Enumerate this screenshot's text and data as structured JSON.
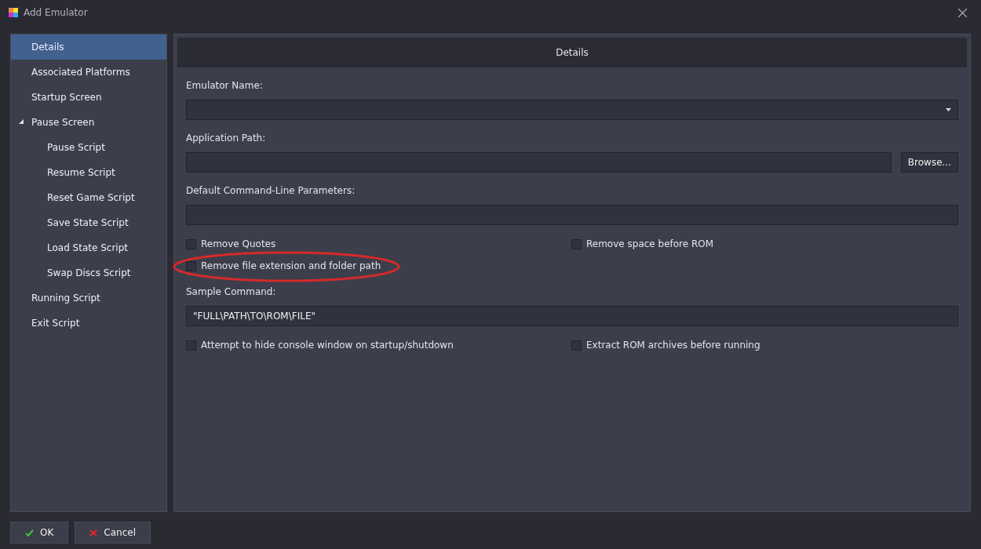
{
  "window": {
    "title": "Add Emulator"
  },
  "sidebar": {
    "items": [
      {
        "label": "Details",
        "selected": true
      },
      {
        "label": "Associated Platforms",
        "selected": false
      },
      {
        "label": "Startup Screen",
        "selected": false
      },
      {
        "label": "Pause Screen",
        "selected": false,
        "expanded": true,
        "children": [
          {
            "label": "Pause Script",
            "selected": false
          },
          {
            "label": "Resume Script",
            "selected": false
          },
          {
            "label": "Reset Game Script",
            "selected": false
          },
          {
            "label": "Save State Script",
            "selected": false
          },
          {
            "label": "Load State Script",
            "selected": false
          },
          {
            "label": "Swap Discs Script",
            "selected": false
          }
        ]
      },
      {
        "label": "Running Script",
        "selected": false
      },
      {
        "label": "Exit Script",
        "selected": false
      }
    ]
  },
  "panel": {
    "header": "Details",
    "emulator_name": {
      "label": "Emulator Name:"
    },
    "application_path": {
      "label": "Application Path:",
      "button": "Browse..."
    },
    "parameters": {
      "label": "Default Command-Line Parameters:"
    },
    "options_1": [
      {
        "label": "Remove Quotes",
        "checked": false
      },
      {
        "label": "Remove space before ROM",
        "checked": false
      },
      {
        "label": "Remove file extension and folder path",
        "checked": false
      }
    ],
    "sample": {
      "label": "Sample Command:",
      "value": "\"FULL\\PATH\\TO\\ROM\\FILE\""
    },
    "options_2": [
      {
        "label": "Attempt to hide console window on startup/shutdown",
        "checked": false
      },
      {
        "label": "Extract ROM archives before running",
        "checked": false
      }
    ]
  },
  "buttons": {
    "ok": "OK",
    "cancel": "Cancel"
  }
}
